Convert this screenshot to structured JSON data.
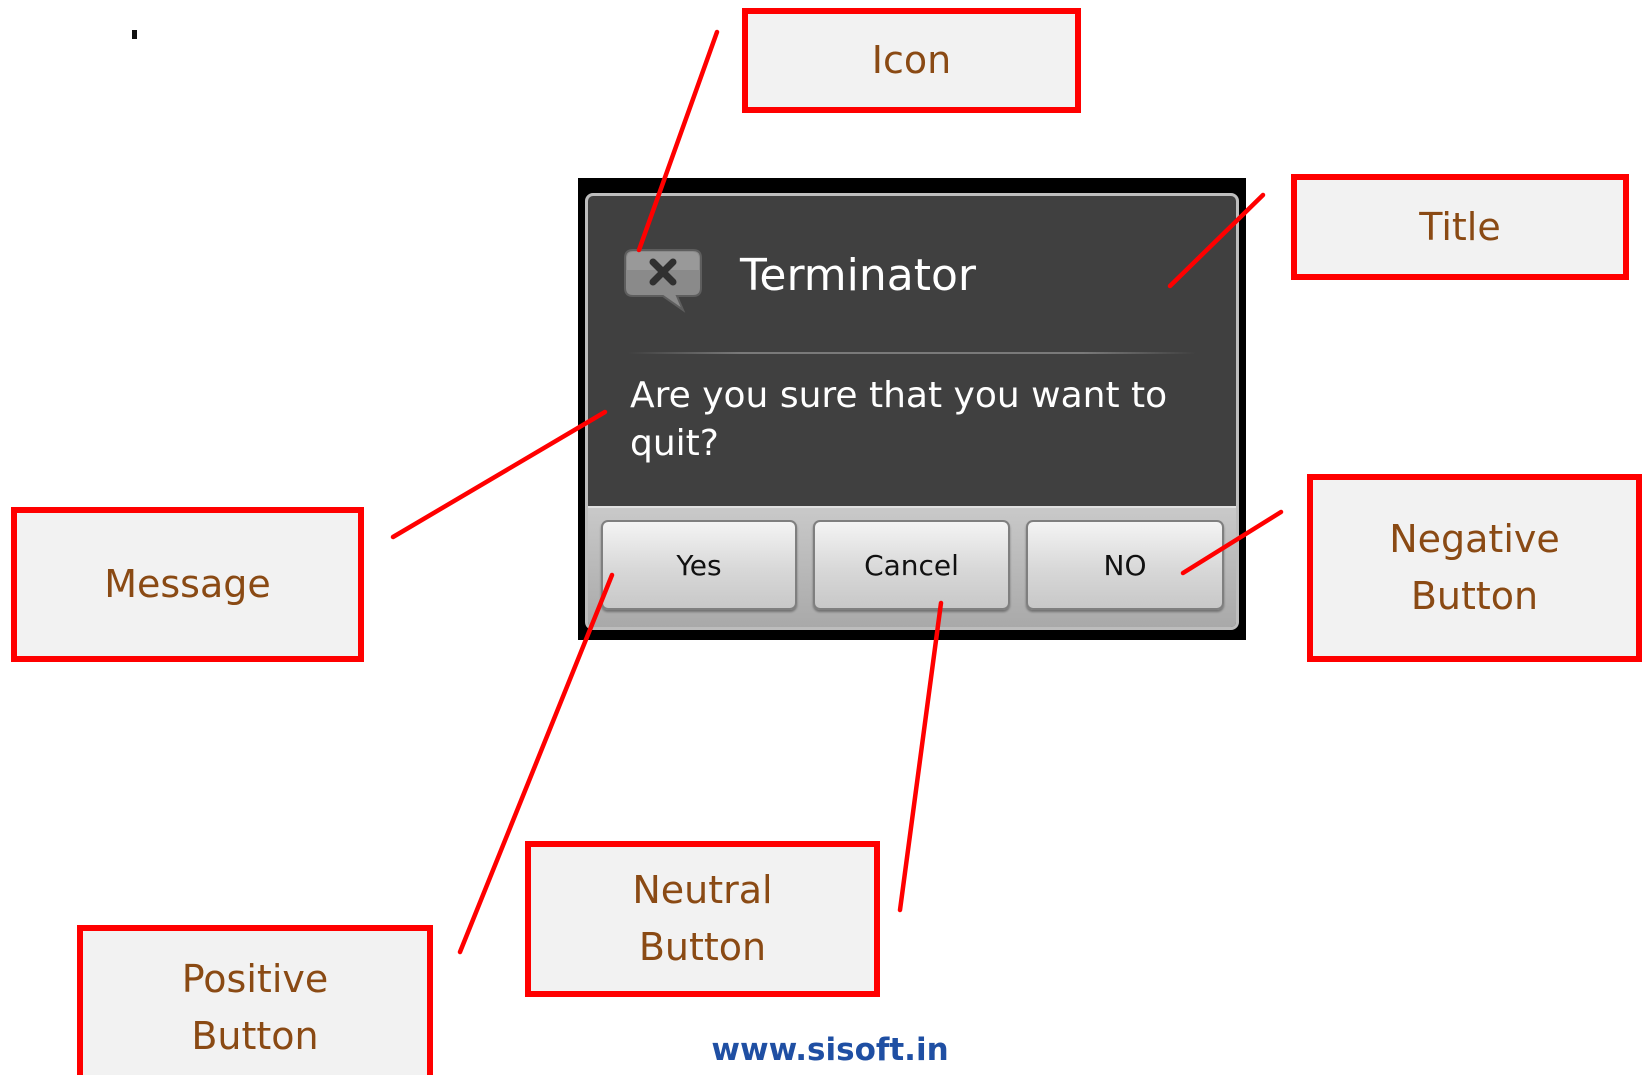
{
  "dialog": {
    "title": "Terminator",
    "message": "Are you sure that you want to quit?",
    "icon": "close-speech-bubble-icon",
    "buttons": {
      "positive": "Yes",
      "neutral": "Cancel",
      "negative": "NO"
    }
  },
  "callouts": {
    "icon": "Icon",
    "title": "Title",
    "message": "Message",
    "negative_line1": "Negative",
    "negative_line2": "Button",
    "positive_line1": "Positive",
    "positive_line2": "Button",
    "neutral_line1": "Neutral",
    "neutral_line2": "Button"
  },
  "footer": {
    "site": "www.sisoft.in"
  },
  "colors": {
    "callout_border": "#ff0000",
    "callout_text": "#8a4a14",
    "callout_fill": "#f2f2f2",
    "dialog_body": "#404040",
    "footer_link": "#1f4fa3"
  }
}
